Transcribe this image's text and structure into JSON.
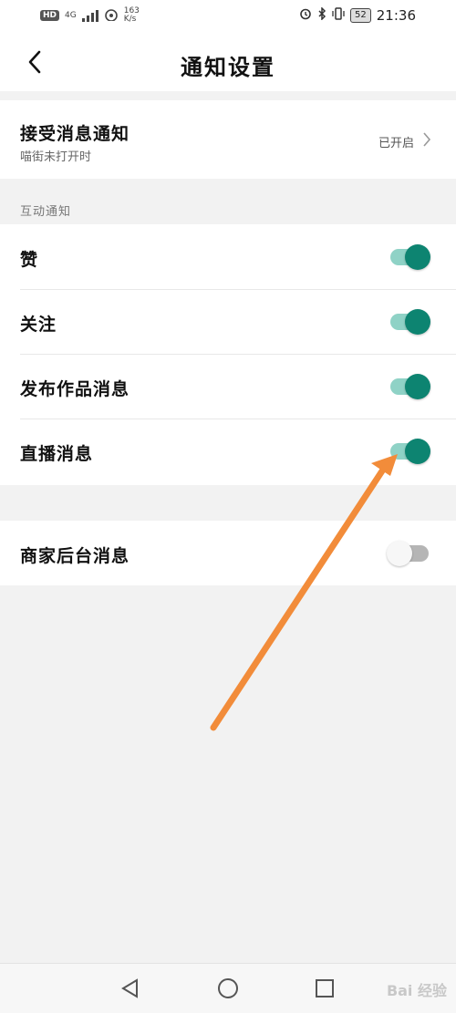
{
  "status_bar": {
    "hd_badge": "HD",
    "signal_label": "4G",
    "net_speed_value": "163",
    "net_speed_unit": "K/s",
    "battery": "52",
    "time": "21:36",
    "icons": [
      "alarm-icon",
      "bluetooth-icon",
      "vibrate-icon",
      "battery-icon"
    ]
  },
  "header": {
    "title": "通知设置",
    "back_icon": "chevron-left-icon"
  },
  "receive_notify": {
    "title": "接受消息通知",
    "subtitle": "喵街未打开时",
    "status": "已开启",
    "chevron_icon": "chevron-right-icon"
  },
  "interaction_section": {
    "header": "互动通知",
    "items": [
      {
        "label": "赞",
        "enabled": true
      },
      {
        "label": "关注",
        "enabled": true
      },
      {
        "label": "发布作品消息",
        "enabled": true
      },
      {
        "label": "直播消息",
        "enabled": true
      }
    ]
  },
  "merchant_section": {
    "items": [
      {
        "label": "商家后台消息",
        "enabled": false
      }
    ]
  },
  "bottom_nav": {
    "icons": [
      "back-triangle-icon",
      "home-circle-icon",
      "recents-square-icon"
    ],
    "watermark": "Bai 经验"
  },
  "colors": {
    "toggle_on_knob": "#0d8471",
    "toggle_on_track": "#8fd2c6",
    "toggle_off_track": "#b5b5b5",
    "annotation_arrow": "#f28c3a"
  }
}
